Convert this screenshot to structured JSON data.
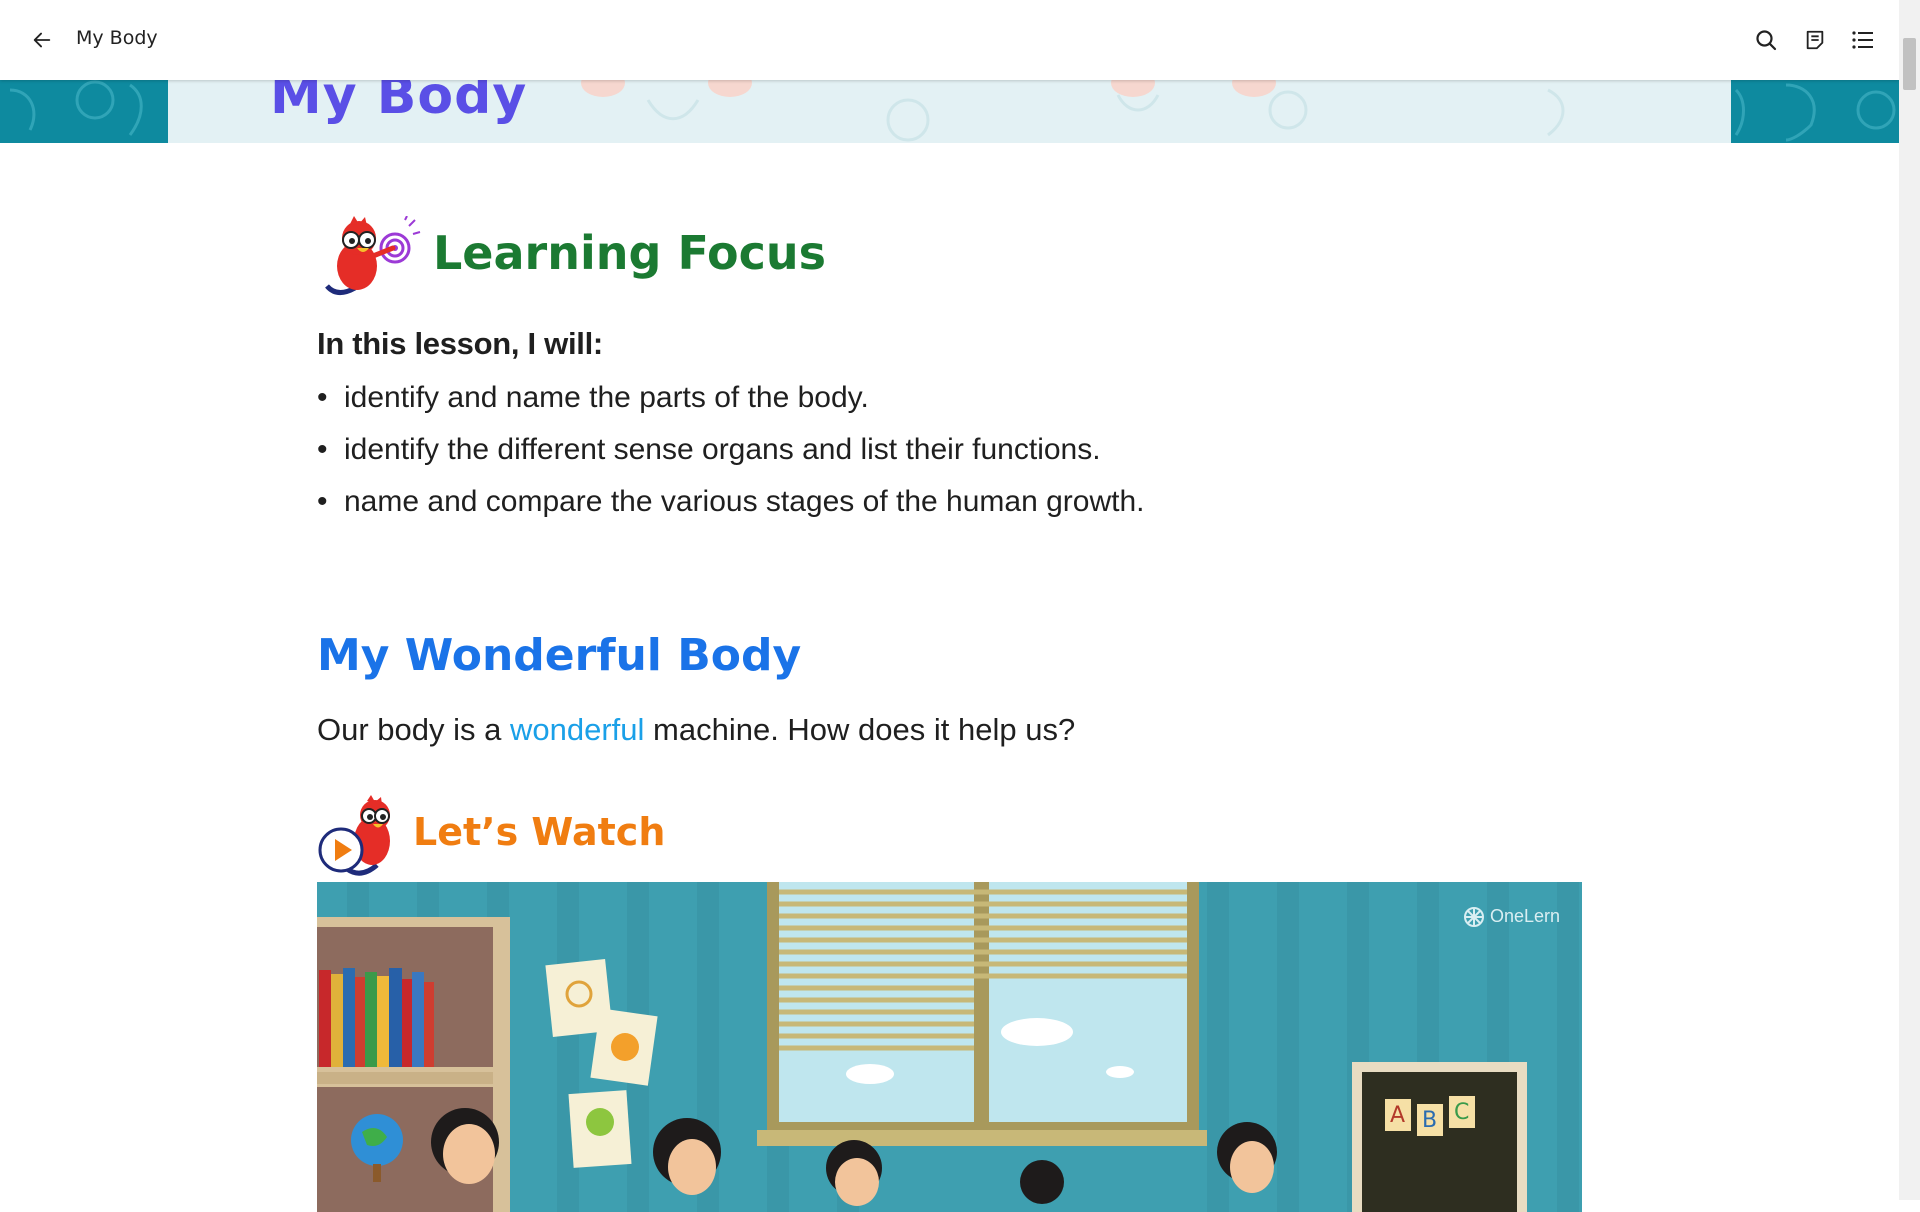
{
  "topbar": {
    "title": "My Body",
    "back_icon": "arrow-left-icon",
    "actions": [
      "search-icon",
      "notes-icon",
      "table-of-contents-icon"
    ]
  },
  "banner": {
    "title": "My Body"
  },
  "learning_focus": {
    "heading": "Learning Focus",
    "lead": "In this lesson, I will:",
    "bullets": [
      "identify and name the parts of the body.",
      "identify the different sense organs and list their functions.",
      "name and compare the various stages of the human growth."
    ]
  },
  "wonderful_body": {
    "heading": "My Wonderful Body",
    "text_before": "Our body is a ",
    "highlight": "wonderful",
    "text_after": " machine. How does it help us?"
  },
  "lets_watch": {
    "heading": "Let’s Watch",
    "video_watermark": "OneLern",
    "board_letters": [
      "A",
      "B",
      "C"
    ]
  },
  "colors": {
    "learning_heading": "#1b7a32",
    "wonder_heading": "#1a73e8",
    "watch_heading": "#f07d11",
    "banner_teal": "#0e8a9f",
    "banner_title": "#5a4fe6",
    "highlight": "#1aa0e8"
  }
}
